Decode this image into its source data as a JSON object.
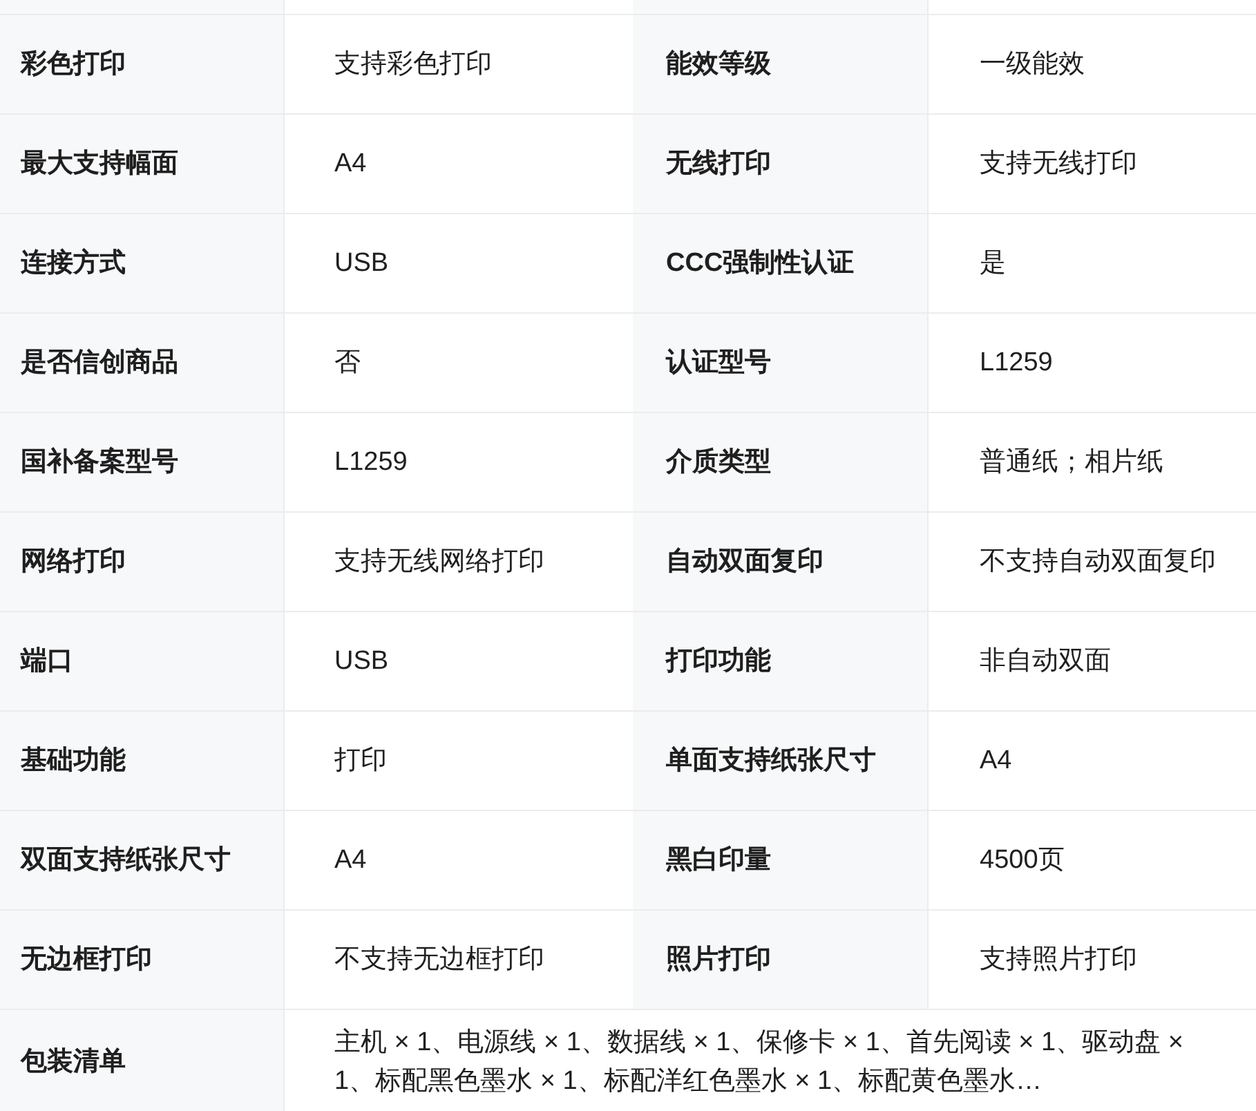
{
  "rows": [
    {
      "kind": "pair",
      "items": [
        {
          "label": "彩色打印",
          "value": "支持彩色打印"
        },
        {
          "label": "能效等级",
          "value": "一级能效"
        }
      ]
    },
    {
      "kind": "pair",
      "items": [
        {
          "label": "最大支持幅面",
          "value": "A4"
        },
        {
          "label": "无线打印",
          "value": "支持无线打印"
        }
      ]
    },
    {
      "kind": "pair",
      "items": [
        {
          "label": "连接方式",
          "value": "USB"
        },
        {
          "label": "CCC强制性认证",
          "value": "是"
        }
      ]
    },
    {
      "kind": "pair",
      "items": [
        {
          "label": "是否信创商品",
          "value": "否"
        },
        {
          "label": "认证型号",
          "value": "L1259"
        }
      ]
    },
    {
      "kind": "pair",
      "items": [
        {
          "label": "国补备案型号",
          "value": "L1259"
        },
        {
          "label": "介质类型",
          "value": "普通纸；相片纸"
        }
      ]
    },
    {
      "kind": "pair",
      "items": [
        {
          "label": "网络打印",
          "value": "支持无线网络打印"
        },
        {
          "label": "自动双面复印",
          "value": "不支持自动双面复印"
        }
      ]
    },
    {
      "kind": "pair",
      "items": [
        {
          "label": "端口",
          "value": "USB"
        },
        {
          "label": "打印功能",
          "value": "非自动双面"
        }
      ]
    },
    {
      "kind": "pair",
      "items": [
        {
          "label": "基础功能",
          "value": "打印"
        },
        {
          "label": "单面支持纸张尺寸",
          "value": "A4"
        }
      ]
    },
    {
      "kind": "pair",
      "items": [
        {
          "label": "双面支持纸张尺寸",
          "value": "A4"
        },
        {
          "label": "黑白印量",
          "value": "4500页"
        }
      ]
    },
    {
      "kind": "pair",
      "items": [
        {
          "label": "无边框打印",
          "value": "不支持无边框打印"
        },
        {
          "label": "照片打印",
          "value": "支持照片打印"
        }
      ]
    },
    {
      "kind": "full",
      "label": "包装清单",
      "value": "主机 × 1、电源线 × 1、数据线 × 1、保修卡 × 1、首先阅读 × 1、驱动盘 × 1、标配黑色墨水 × 1、标配洋红色墨水 × 1、标配黄色墨水…"
    }
  ]
}
